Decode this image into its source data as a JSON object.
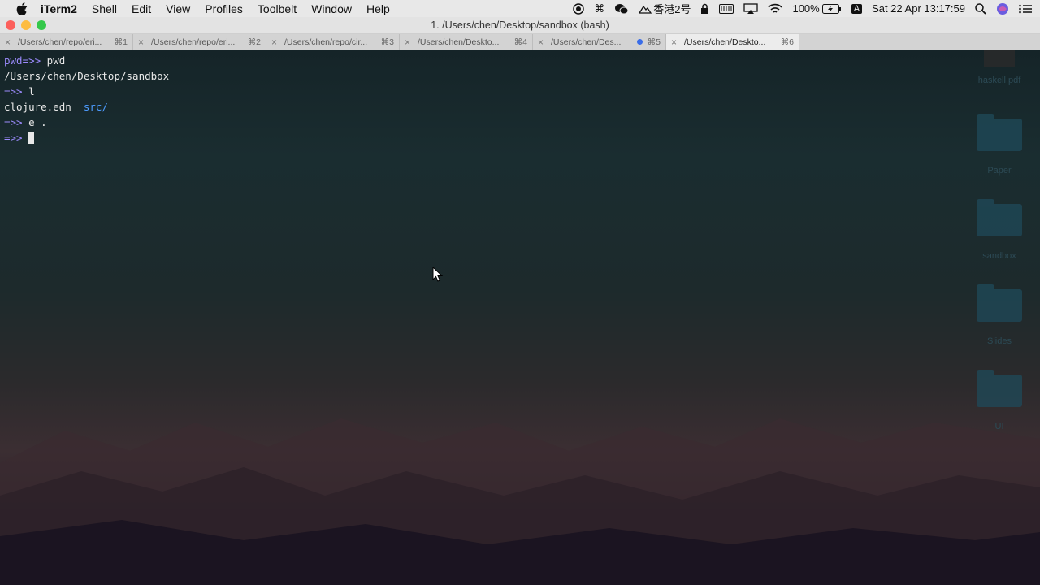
{
  "menubar": {
    "items": [
      "iTerm2",
      "Shell",
      "Edit",
      "View",
      "Profiles",
      "Toolbelt",
      "Window",
      "Help"
    ],
    "status": {
      "input_label": "香港2号",
      "battery": "100%",
      "input_source": "A",
      "datetime": "Sat 22 Apr  13:17:59"
    }
  },
  "window": {
    "title": "1. /Users/chen/Desktop/sandbox (bash)"
  },
  "tabs": [
    {
      "title": "/Users/chen/repo/eri...",
      "shortcut": "⌘1"
    },
    {
      "title": "/Users/chen/repo/eri...",
      "shortcut": "⌘2"
    },
    {
      "title": "/Users/chen/repo/cir...",
      "shortcut": "⌘3"
    },
    {
      "title": "/Users/chen/Deskto...",
      "shortcut": "⌘4"
    },
    {
      "title": "/Users/chen/Des...",
      "shortcut": "⌘5"
    },
    {
      "title": "/Users/chen/Deskto...",
      "shortcut": "⌘6"
    }
  ],
  "terminal": {
    "line1_prompt": "pwd=>>",
    "line1_cmd": " pwd",
    "line2_output": "/Users/chen/Desktop/sandbox",
    "line3_prompt": "=>>",
    "line3_cmd": " l",
    "line4_file": "clojure.edn",
    "line4_dir": "src/",
    "line5_prompt": "=>>",
    "line5_cmd": " e .",
    "line6_prompt": "=>>"
  },
  "desktop": {
    "icons": [
      "haskell.pdf",
      "Paper",
      "sandbox",
      "Slides",
      "UI"
    ]
  },
  "colors": {
    "prompt": "#9d8cff",
    "directory": "#4d9cff",
    "close": "#fc605c",
    "minimize": "#fdbc40",
    "maximize": "#34c84a"
  }
}
